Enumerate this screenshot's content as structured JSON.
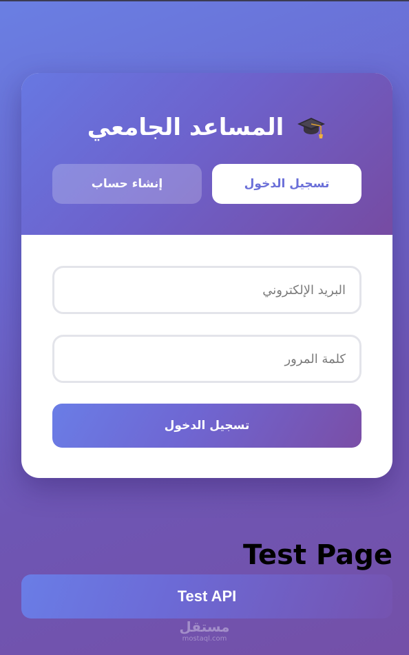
{
  "header": {
    "title": "المساعد الجامعي",
    "icon": "graduation-cap-icon"
  },
  "tabs": {
    "login_label": "تسجيل الدخول",
    "register_label": "إنشاء حساب"
  },
  "form": {
    "email_placeholder": "البريد الإلكتروني",
    "password_placeholder": "كلمة المرور",
    "submit_label": "تسجيل الدخول"
  },
  "test": {
    "page_title": "Test Page",
    "api_button_label": "Test API"
  },
  "watermark": {
    "main": "مستقل",
    "sub": "mostaql.com"
  },
  "colors": {
    "accent": "#6a6fd8",
    "gradient_start": "#667eea",
    "gradient_end": "#764ba2"
  }
}
